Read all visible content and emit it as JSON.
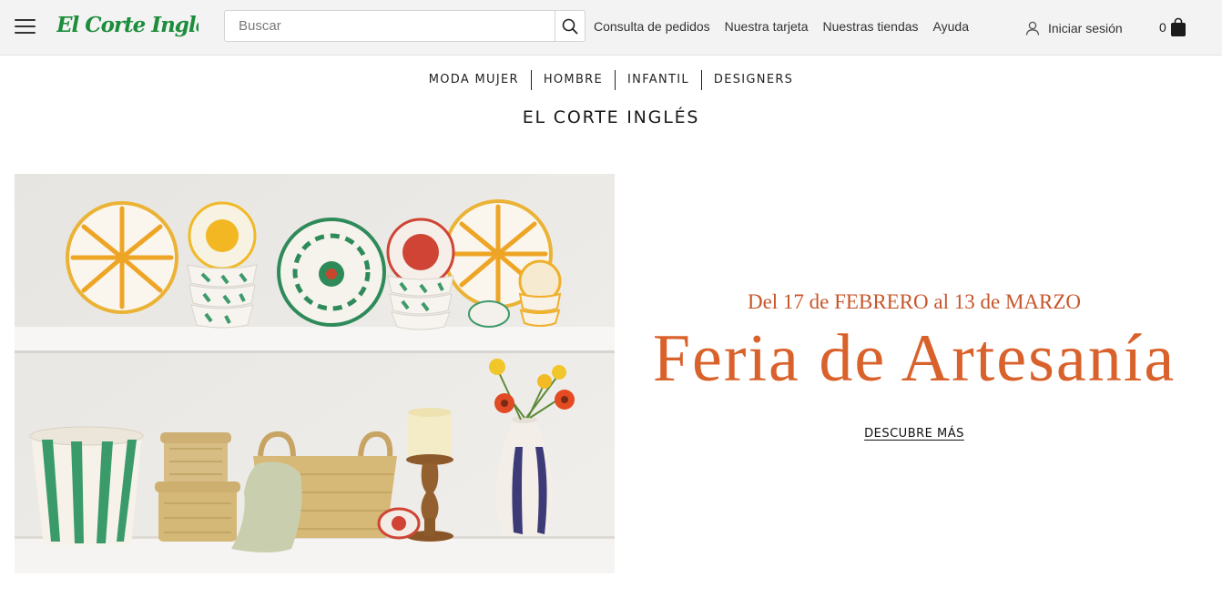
{
  "header": {
    "menu_icon": "hamburger-menu-icon",
    "logo_text": "El Corte Inglés",
    "logo_color": "#1d8d3c",
    "search": {
      "placeholder": "Buscar",
      "value": "",
      "icon": "search-icon"
    },
    "links": [
      "Consulta de pedidos",
      "Nuestra tarjeta",
      "Nuestras tiendas",
      "Ayuda"
    ],
    "login": {
      "label": "Iniciar sesión",
      "icon": "user-icon"
    },
    "cart": {
      "count": "0",
      "icon": "shopping-bag-icon"
    }
  },
  "category_nav": [
    "MODA MUJER",
    "HOMBRE",
    "INFANTIL",
    "DESIGNERS"
  ],
  "brand_title": "EL CORTE INGLÉS",
  "banner": {
    "dates": "Del 17 de FEBRERO al 13 de MARZO",
    "headline": "Feria de Artesanía",
    "cta": "DESCUBRE MÁS",
    "accent_color": "#d9622c",
    "image_alt": "Cerámica y cestería artesanal en estanterías blancas"
  }
}
